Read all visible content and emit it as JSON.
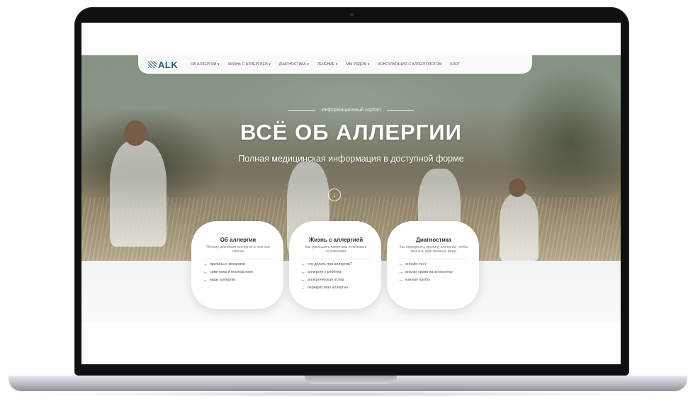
{
  "nav": {
    "logo": "ALK",
    "items": [
      "ОБ АЛЛЕРГИИ ▾",
      "ЖИЗНЬ С АЛЛЕРГИЕЙ ▾",
      "ДИАГНОСТИКА ▾",
      "ЛЕЧЕНИЕ ▾",
      "МЫ РЯДОМ ▾",
      "КОНСУЛЬТАЦИЯ С АЛЛЕРГОЛОГОМ",
      "БЛОГ"
    ]
  },
  "hero": {
    "portal": "Информационный портал",
    "title": "ВСЁ ОБ АЛЛЕРГИИ",
    "subtitle": "Полная медицинская информация в доступной форме",
    "scroll_icon": "arrow-down-circle-icon"
  },
  "cards": [
    {
      "title": "Об аллергии",
      "desc": "Почему возникает аллергия и чем она опасна",
      "links": [
        "причины и механизм",
        "симптомы и последствия",
        "виды аллергии"
      ]
    },
    {
      "title": "Жизнь с аллергией",
      "desc": "Как уменьшить симптомы и избежать осложнений",
      "links": [
        "что делать при аллергии?",
        "аллергия у ребёнка",
        "аллергическая астма",
        "перекрёстная аллергия"
      ]
    },
    {
      "title": "Диагностика",
      "desc": "Как определить причину аллергии, чтобы принять действенные меры",
      "links": [
        "онлайн-тест",
        "анализ крови на аллергены",
        "кожные пробы"
      ]
    }
  ],
  "colors": {
    "brand": "#2f5a78",
    "frame": "#0f1012"
  }
}
